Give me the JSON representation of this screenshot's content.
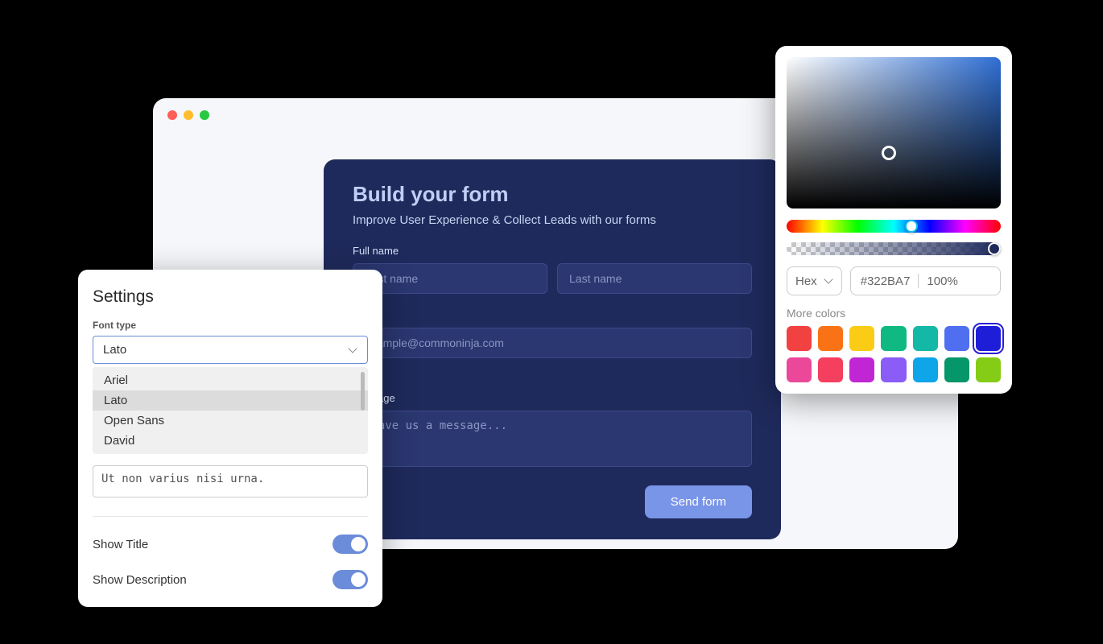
{
  "form": {
    "title": "Build your form",
    "subtitle": "Improve User Experience & Collect Leads with our forms",
    "fields": {
      "full_name_label": "Full name",
      "first_name_placeholder": "First name",
      "last_name_placeholder": "Last name",
      "email_placeholder": "example@commoninja.com",
      "message_label": "Message",
      "message_placeholder": "Leave us a message..."
    },
    "submit_label": "Send form"
  },
  "settings": {
    "title": "Settings",
    "font_type_label": "Font type",
    "font_selected": "Lato",
    "font_options": [
      "Ariel",
      "Lato",
      "Open Sans",
      "David"
    ],
    "sample_text": "Ut non varius nisi urna.",
    "show_title_label": "Show Title",
    "show_title_value": true,
    "show_description_label": "Show Description",
    "show_description_value": true
  },
  "picker": {
    "format_label": "Hex",
    "hex_value": "#322BA7",
    "alpha_value": "100%",
    "more_colors_label": "More colors",
    "swatches": [
      "#f24141",
      "#f97316",
      "#facc15",
      "#10b981",
      "#14b8a6",
      "#4f6ff0",
      "#1e1ed9",
      "#ec4899",
      "#f43f5e",
      "#c026d3",
      "#8b5cf6",
      "#0ea5e9",
      "#059669",
      "#84cc16"
    ],
    "selected_swatch_index": 6
  }
}
